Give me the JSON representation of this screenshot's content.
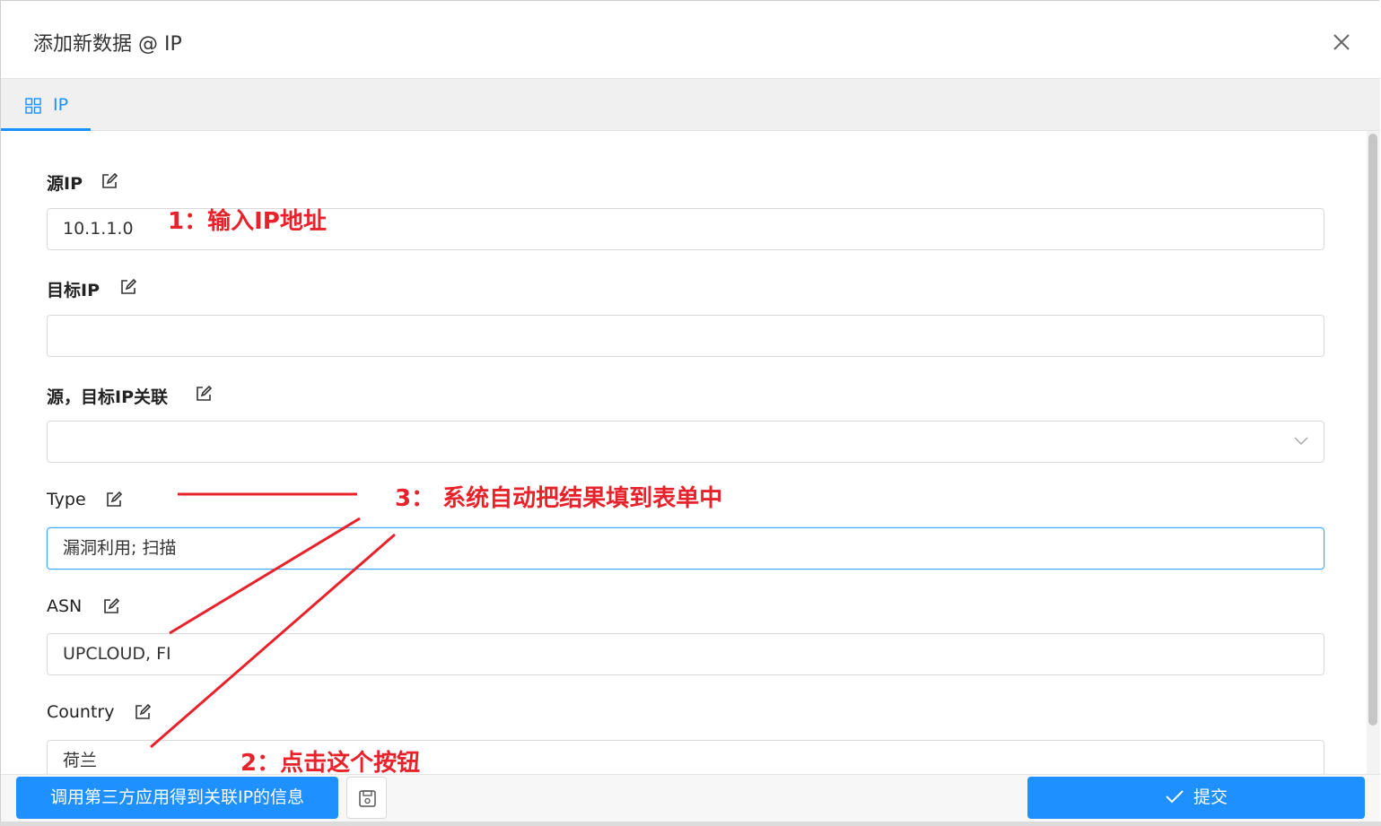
{
  "dialog": {
    "title": "添加新数据 @ IP",
    "close_icon": "close-icon"
  },
  "tabs": [
    {
      "label": "IP",
      "icon": "grid-icon",
      "active": true
    }
  ],
  "fields": {
    "source_ip": {
      "label": "源IP",
      "value": "10.1.1.0"
    },
    "target_ip": {
      "label": "目标IP",
      "value": ""
    },
    "relation": {
      "label": "源，目标IP关联",
      "value": ""
    },
    "type": {
      "label": "Type",
      "value": "漏洞利用; 扫描"
    },
    "asn": {
      "label": "ASN",
      "value": "UPCLOUD, FI"
    },
    "country": {
      "label": "Country",
      "value": "荷兰"
    }
  },
  "footer": {
    "fetch_label": "调用第三方应用得到关联IP的信息",
    "submit_label": "提交",
    "save_icon": "save-icon"
  },
  "annotations": {
    "step1": "1：输入IP地址",
    "step2": "2：点击这个按钮",
    "step3": "3：  系统自动把结果填到表单中"
  },
  "colors": {
    "primary": "#1e90ff",
    "annotation": "#e8222a"
  }
}
